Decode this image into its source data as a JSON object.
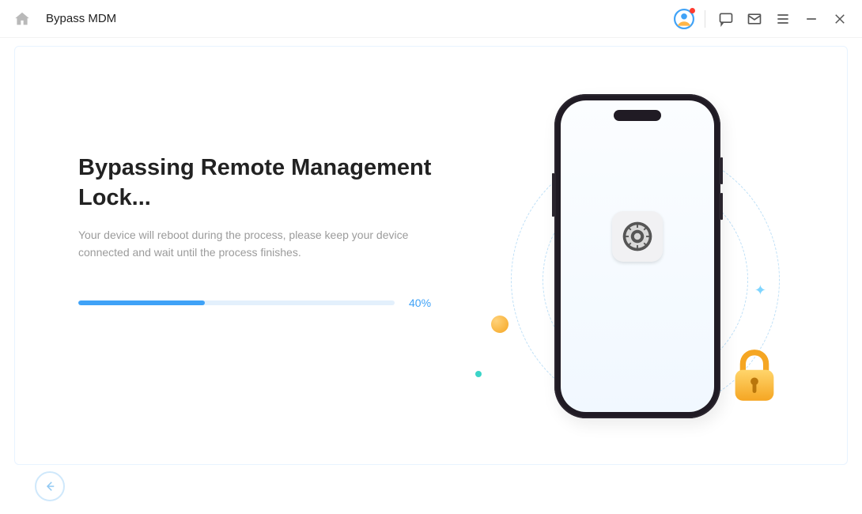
{
  "header": {
    "title": "Bypass MDM"
  },
  "main": {
    "heading": "Bypassing Remote Management Lock...",
    "description": "Your device will reboot during the process, please keep your device connected and wait until the process finishes.",
    "progress": {
      "percent": 40,
      "label": "40%"
    }
  },
  "colors": {
    "accent": "#3fa2f7",
    "track": "#e3f0fc",
    "text_muted": "#9b9b9b",
    "alert_dot": "#ff3b30"
  },
  "icons": {
    "home": "home-icon",
    "avatar": "avatar-icon",
    "chat": "chat-icon",
    "mail": "mail-icon",
    "menu": "menu-icon",
    "minimize": "minimize-icon",
    "close": "close-icon",
    "back": "back-icon",
    "settings_gear": "settings-gear-icon",
    "padlock": "padlock-icon",
    "phone": "phone-illustration"
  }
}
